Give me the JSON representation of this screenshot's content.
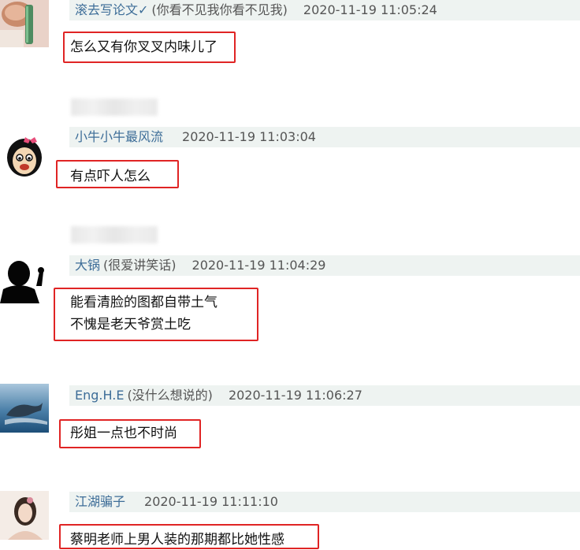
{
  "comments": [
    {
      "name": "滚去写论文✓",
      "note": "(你看不见我你看不见我)",
      "time": "2020-11-19 11:05:24",
      "lines": [
        "怎么又有你叉叉内味儿了"
      ]
    },
    {
      "name": "小牛小牛最风流",
      "note": "",
      "time": "2020-11-19 11:03:04",
      "lines": [
        "有点吓人怎么"
      ]
    },
    {
      "name": "大锅",
      "note": "(很爱讲笑话)",
      "time": "2020-11-19 11:04:29",
      "lines": [
        "能看清脸的图都自带土气",
        "不愧是老天爷赏土吃"
      ]
    },
    {
      "name": "Eng.H.E",
      "note": "(没什么想说的)",
      "time": "2020-11-19 11:06:27",
      "lines": [
        "彤姐一点也不时尚"
      ]
    },
    {
      "name": "江湖骗子",
      "note": "",
      "time": "2020-11-19 11:11:10",
      "lines": [
        "蔡明老师上男人装的那期都比她性感"
      ]
    }
  ],
  "colors": {
    "highlight": "#e02424",
    "name": "#3d6d98",
    "header_bg": "#eef3f1"
  }
}
